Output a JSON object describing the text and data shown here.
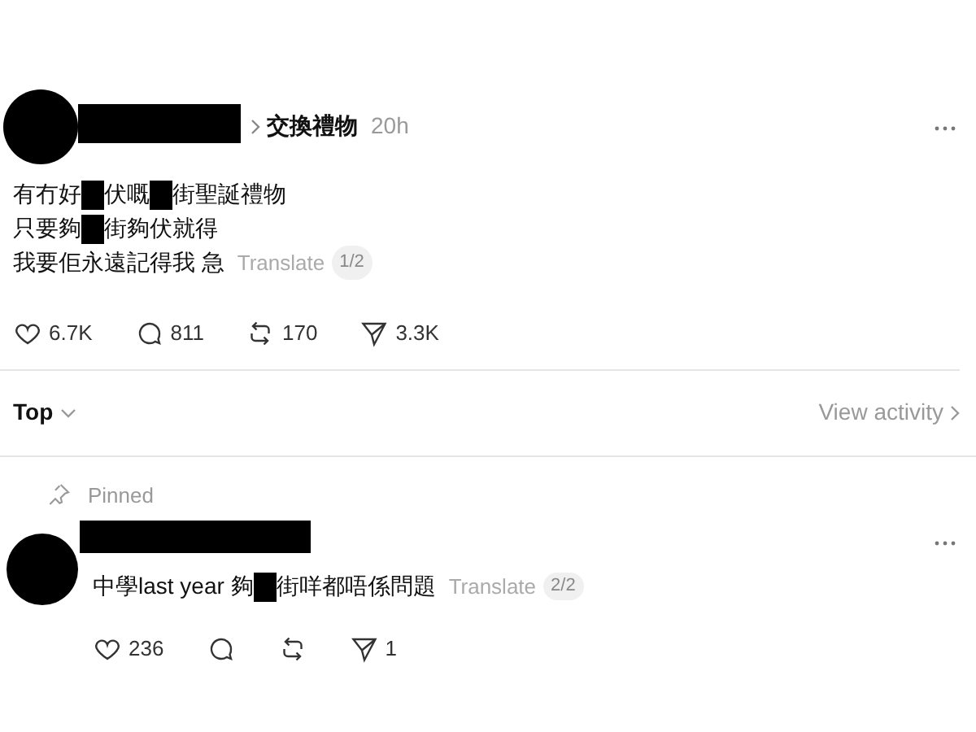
{
  "post": {
    "topic": "交換禮物",
    "time": "20h",
    "lines": [
      [
        {
          "kind": "text",
          "text": "有冇好"
        },
        {
          "kind": "redacted"
        },
        {
          "kind": "text",
          "text": "伏嘅"
        },
        {
          "kind": "redacted"
        },
        {
          "kind": "text",
          "text": "街聖誕禮物"
        }
      ],
      [
        {
          "kind": "text",
          "text": "只要夠"
        },
        {
          "kind": "redacted"
        },
        {
          "kind": "text",
          "text": "街夠伏就得"
        }
      ],
      [
        {
          "kind": "text",
          "text": "我要佢永遠記得我 急"
        }
      ]
    ],
    "translate": "Translate",
    "page": "1/2",
    "actions": [
      {
        "kind": "like",
        "count": "6.7K"
      },
      {
        "kind": "comment",
        "count": "811"
      },
      {
        "kind": "repost",
        "count": "170"
      },
      {
        "kind": "share",
        "count": "3.3K"
      }
    ]
  },
  "sort": {
    "label": "Top",
    "link": "View activity"
  },
  "reply": {
    "pinned": "Pinned",
    "segments": [
      {
        "kind": "text",
        "text": "中學last year 夠"
      },
      {
        "kind": "redacted"
      },
      {
        "kind": "text",
        "text": "街咩都唔係問題"
      }
    ],
    "translate": "Translate",
    "page": "2/2",
    "actions": [
      {
        "kind": "like",
        "count": "236"
      },
      {
        "kind": "comment"
      },
      {
        "kind": "repost"
      },
      {
        "kind": "share",
        "count": "1"
      }
    ]
  }
}
